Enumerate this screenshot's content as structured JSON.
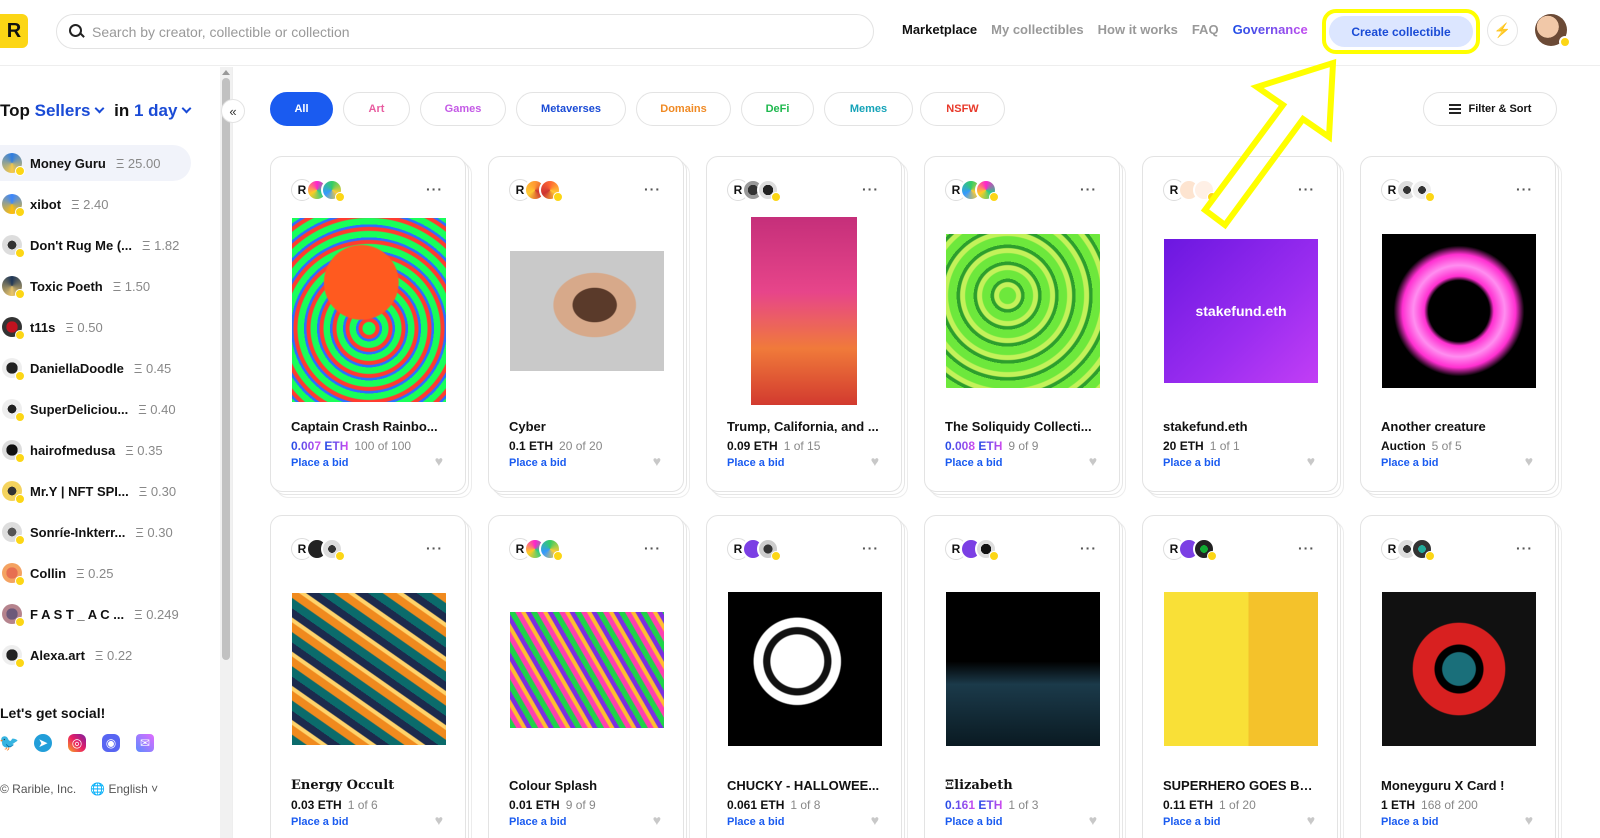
{
  "header": {
    "logo_text": "R",
    "search_placeholder": "Search by creator, collectible or collection",
    "nav": [
      "Marketplace",
      "My collectibles",
      "How it works",
      "FAQ",
      "Governance"
    ],
    "create_label": "Create collectible",
    "bolt_icon": "⚡"
  },
  "sidebar": {
    "title_prefix": "Top",
    "title_kind": "Sellers",
    "title_in": "in",
    "title_period": "1 day",
    "collapse_glyph": "«",
    "sellers": [
      {
        "name": "Money Guru",
        "value": "Ξ 25.00"
      },
      {
        "name": "xibot",
        "value": "Ξ 2.40"
      },
      {
        "name": "Don't Rug Me (...",
        "value": "Ξ 1.82"
      },
      {
        "name": "Toxic Poeth",
        "value": "Ξ 1.50"
      },
      {
        "name": "t11s",
        "value": "Ξ 0.50"
      },
      {
        "name": "DaniellaDoodle",
        "value": "Ξ 0.45"
      },
      {
        "name": "SuperDeliciou...",
        "value": "Ξ 0.40"
      },
      {
        "name": "hairofmedusa",
        "value": "Ξ 0.35"
      },
      {
        "name": "Mr.Y | NFT SPI...",
        "value": "Ξ 0.30"
      },
      {
        "name": "Sonríe-Inkterr...",
        "value": "Ξ 0.30"
      },
      {
        "name": "Collin",
        "value": "Ξ 0.25"
      },
      {
        "name": "F A S T _ A C ...",
        "value": "Ξ 0.249"
      },
      {
        "name": "Alexa.art",
        "value": "Ξ 0.22"
      }
    ],
    "social_title": "Let's get social!",
    "company": "© Rarible, Inc.",
    "language": "English"
  },
  "filters": {
    "pills": [
      "All",
      "Art",
      "Games",
      "Metaverses",
      "Domains",
      "DeFi",
      "Memes",
      "NSFW"
    ],
    "sort_label": "Filter & Sort"
  },
  "cards": [
    {
      "title": "Captain Crash Rainbo...",
      "price": "0.007",
      "unit": "ETH",
      "grad": true,
      "stock": "100 of 100",
      "bid": "Place a bid"
    },
    {
      "title": "Cyber",
      "price": "0.1",
      "unit": "ETH",
      "grad": false,
      "stock": "20 of 20",
      "bid": "Place a bid"
    },
    {
      "title": "Trump, California, and ...",
      "price": "0.09",
      "unit": "ETH",
      "grad": false,
      "stock": "1 of 15",
      "bid": "Place a bid"
    },
    {
      "title": "The Soliquidy Collecti...",
      "price": "0.008",
      "unit": "ETH",
      "grad": true,
      "stock": "9 of 9",
      "bid": "Place a bid"
    },
    {
      "title": "stakefund.eth",
      "price": "20",
      "unit": "ETH",
      "grad": false,
      "stock": "1 of 1",
      "bid": "Place a bid",
      "img_text": "stakefund.eth"
    },
    {
      "title": "Another creature",
      "price": "Auction",
      "unit": "",
      "grad": false,
      "stock": "5 of 5",
      "bid": "Place a bid"
    },
    {
      "title": "Energy Occult",
      "price": "0.03",
      "unit": "ETH",
      "grad": false,
      "stock": "1 of 6",
      "bid": "Place a bid"
    },
    {
      "title": "Colour Splash",
      "price": "0.01",
      "unit": "ETH",
      "grad": false,
      "stock": "9 of 9",
      "bid": "Place a bid"
    },
    {
      "title": "CHUCKY - HALLOWEE...",
      "price": "0.061",
      "unit": "ETH",
      "grad": false,
      "stock": "1 of 8",
      "bid": "Place a bid"
    },
    {
      "title": "Ξlizabeth",
      "price": "0.161",
      "unit": "ETH",
      "grad": true,
      "stock": "1 of 3",
      "bid": "Place a bid"
    },
    {
      "title": "SUPERHERO GOES BR...",
      "price": "0.11",
      "unit": "ETH",
      "grad": false,
      "stock": "1 of 20",
      "bid": "Place a bid"
    },
    {
      "title": "Moneyguru X Card !",
      "price": "1",
      "unit": "ETH",
      "grad": false,
      "stock": "168 of 200",
      "bid": "Place a bid"
    }
  ],
  "colors": {
    "accent": "#1a5bf0",
    "brand_yellow": "#fcd615",
    "highlight": "#ffff00"
  }
}
